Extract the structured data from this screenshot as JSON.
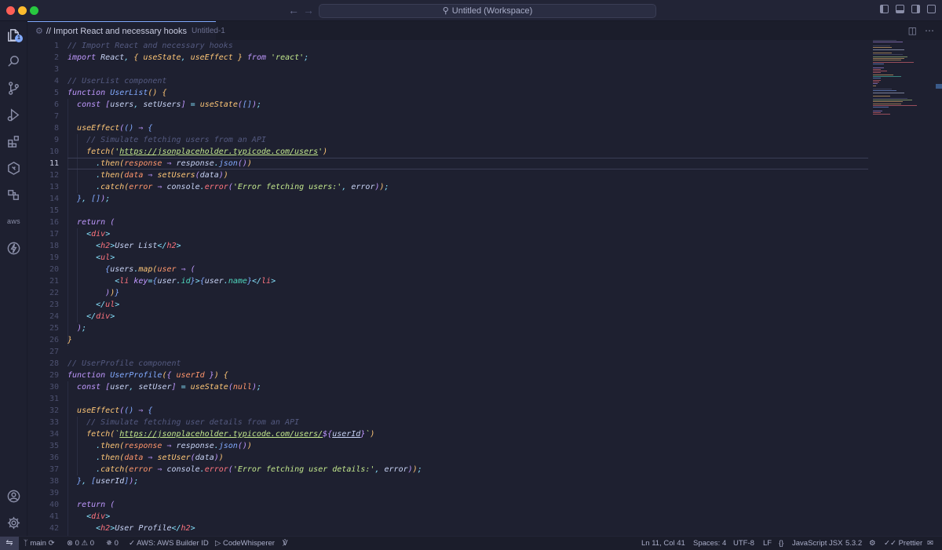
{
  "titlebar": {
    "workspace_title": "Untitled (Workspace)",
    "back_icon": "arrow-left-icon",
    "forward_icon": "arrow-right-icon"
  },
  "activity_bar": {
    "explorer_badge": "1",
    "aws_label": "aws"
  },
  "tab": {
    "name": "// Import React and necessary hooks",
    "description": "Untitled-1"
  },
  "editor": {
    "current_line": 11,
    "lines": [
      "1",
      "2",
      "3",
      "4",
      "5",
      "6",
      "7",
      "8",
      "9",
      "10",
      "11",
      "12",
      "13",
      "14",
      "15",
      "16",
      "17",
      "18",
      "19",
      "20",
      "21",
      "22",
      "23",
      "24",
      "25",
      "26",
      "27",
      "28",
      "29",
      "30",
      "31",
      "32",
      "33",
      "34",
      "35",
      "36",
      "37",
      "38",
      "39",
      "40",
      "41",
      "42"
    ],
    "code": {
      "l1": "// Import React and necessary hooks",
      "l2_kw": "import",
      "l2_react": "React",
      "l2_usestate": "useState",
      "l2_useeffect": "useEffect",
      "l2_from": "from",
      "l2_str": "'react'",
      "l4": "// UserList component",
      "l5_kw": "function",
      "l5_name": "UserList",
      "l6_kw": "const",
      "l6_users": "users",
      "l6_setusers": "setUsers",
      "l6_usestate": "useState",
      "l8_useeffect": "useEffect",
      "l9": "// Simulate fetching users from an API",
      "l10_fetch": "fetch",
      "l10_url": "https://jsonplaceholder.typicode.com/users",
      "l11_then": "then",
      "l11_resp": "response",
      "l11_resp2": "response",
      "l11_json": "json",
      "l12_then": "then",
      "l12_data": "data",
      "l12_setusers": "setUsers",
      "l12_data2": "data",
      "l13_catch": "catch",
      "l13_error": "error",
      "l13_console": "console",
      "l13_errfn": "error",
      "l13_str": "'Error fetching users:'",
      "l13_error2": "error",
      "l16_return": "return",
      "l17_tag": "div",
      "l18_tag": "h2",
      "l18_text": "User List",
      "l19_tag": "ul",
      "l20_users": "users",
      "l20_map": "map",
      "l20_user": "user",
      "l21_tag": "li",
      "l21_attr": "key",
      "l21_user": "user",
      "l21_id": "id",
      "l21_user2": "user",
      "l21_name": "name",
      "l28": "// UserProfile component",
      "l29_kw": "function",
      "l29_name": "UserProfile",
      "l29_param": "userId",
      "l30_kw": "const",
      "l30_user": "user",
      "l30_setuser": "setUser",
      "l30_usestate": "useState",
      "l30_null": "null",
      "l32_useeffect": "useEffect",
      "l33": "// Simulate fetching user details from an API",
      "l34_fetch": "fetch",
      "l34_url": "https://jsonplaceholder.typicode.com/users/",
      "l34_param": "userId",
      "l35_then": "then",
      "l35_resp": "response",
      "l35_resp2": "response",
      "l35_json": "json",
      "l36_then": "then",
      "l36_data": "data",
      "l36_setuser": "setUser",
      "l36_data2": "data",
      "l37_catch": "catch",
      "l37_error": "error",
      "l37_console": "console",
      "l37_errfn": "error",
      "l37_str": "'Error fetching user details:'",
      "l37_error2": "error",
      "l38_param": "userId",
      "l40_return": "return",
      "l41_tag": "div",
      "l42_tag": "h2",
      "l42_text": "User Profile"
    }
  },
  "statusbar": {
    "branch": "main",
    "errors": "0",
    "warnings": "0",
    "ports": "0",
    "aws": "AWS: AWS Builder ID",
    "codewhisperer": "CodeWhisperer",
    "position": "Ln 11, Col 41",
    "spaces": "Spaces: 4",
    "encoding": "UTF-8",
    "eol": "LF",
    "language": "JavaScript JSX",
    "ts_version": "5.3.2",
    "prettier": "Prettier"
  },
  "colors": {
    "background": "#1e2030",
    "accent": "#82aaff",
    "keyword": "#c099ff",
    "string": "#c3e88d",
    "function": "#ffc777",
    "comment": "#545a80"
  }
}
